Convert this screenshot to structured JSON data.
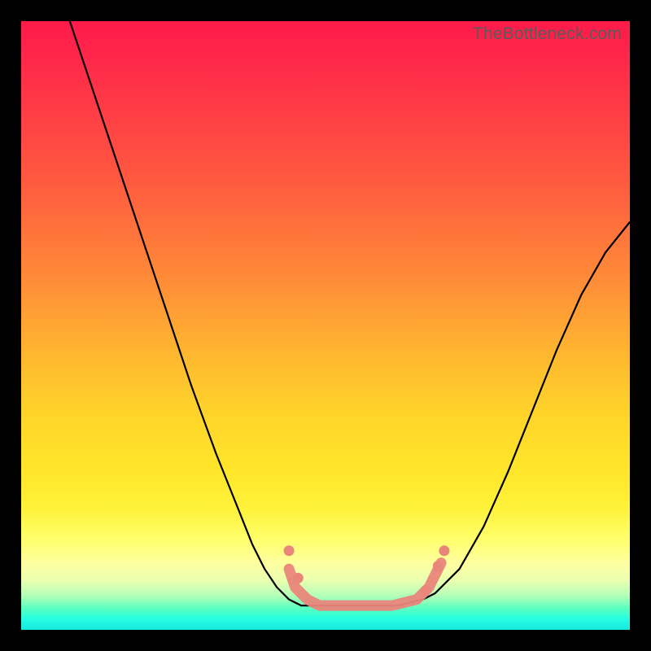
{
  "watermark": "TheBottleneck.com",
  "colors": {
    "frame": "#000000",
    "curve": "#000000",
    "marker_fill": "#e9867b",
    "marker_stroke": "#d46a60"
  },
  "chart_data": {
    "type": "line",
    "title": "",
    "xlabel": "",
    "ylabel": "",
    "xlim": [
      0,
      100
    ],
    "ylim": [
      0,
      100
    ],
    "note": "No axis ticks or numeric labels are rendered; values are estimated from pixel positions in a 0–100 normalized coordinate space (origin bottom-left).",
    "series": [
      {
        "name": "left-curve",
        "x": [
          8,
          12,
          16,
          20,
          24,
          28,
          32,
          36,
          38,
          40,
          42,
          44,
          46
        ],
        "y": [
          100,
          88,
          76,
          64,
          52,
          40,
          29,
          19,
          14,
          10,
          7,
          5,
          4
        ]
      },
      {
        "name": "right-curve",
        "x": [
          68,
          72,
          76,
          80,
          84,
          88,
          92,
          96,
          100
        ],
        "y": [
          6,
          10,
          17,
          26,
          36,
          46,
          55,
          62,
          67
        ]
      },
      {
        "name": "flat-bottom",
        "x": [
          46,
          50,
          54,
          58,
          62,
          66,
          68
        ],
        "y": [
          4,
          4,
          4,
          4,
          4,
          5,
          6
        ]
      }
    ],
    "markers": {
      "name": "salmon-dots",
      "note": "Short segments of thick salmon-colored markers overlaying the curve near the trough.",
      "points": [
        {
          "x": 44,
          "y": 10
        },
        {
          "x": 45,
          "y": 7
        },
        {
          "x": 47,
          "y": 5
        },
        {
          "x": 49,
          "y": 4
        },
        {
          "x": 52,
          "y": 4
        },
        {
          "x": 55,
          "y": 4
        },
        {
          "x": 58,
          "y": 4
        },
        {
          "x": 61,
          "y": 4
        },
        {
          "x": 63,
          "y": 4.5
        },
        {
          "x": 65,
          "y": 5
        },
        {
          "x": 67,
          "y": 7
        },
        {
          "x": 68,
          "y": 9
        },
        {
          "x": 69,
          "y": 11
        }
      ]
    }
  }
}
